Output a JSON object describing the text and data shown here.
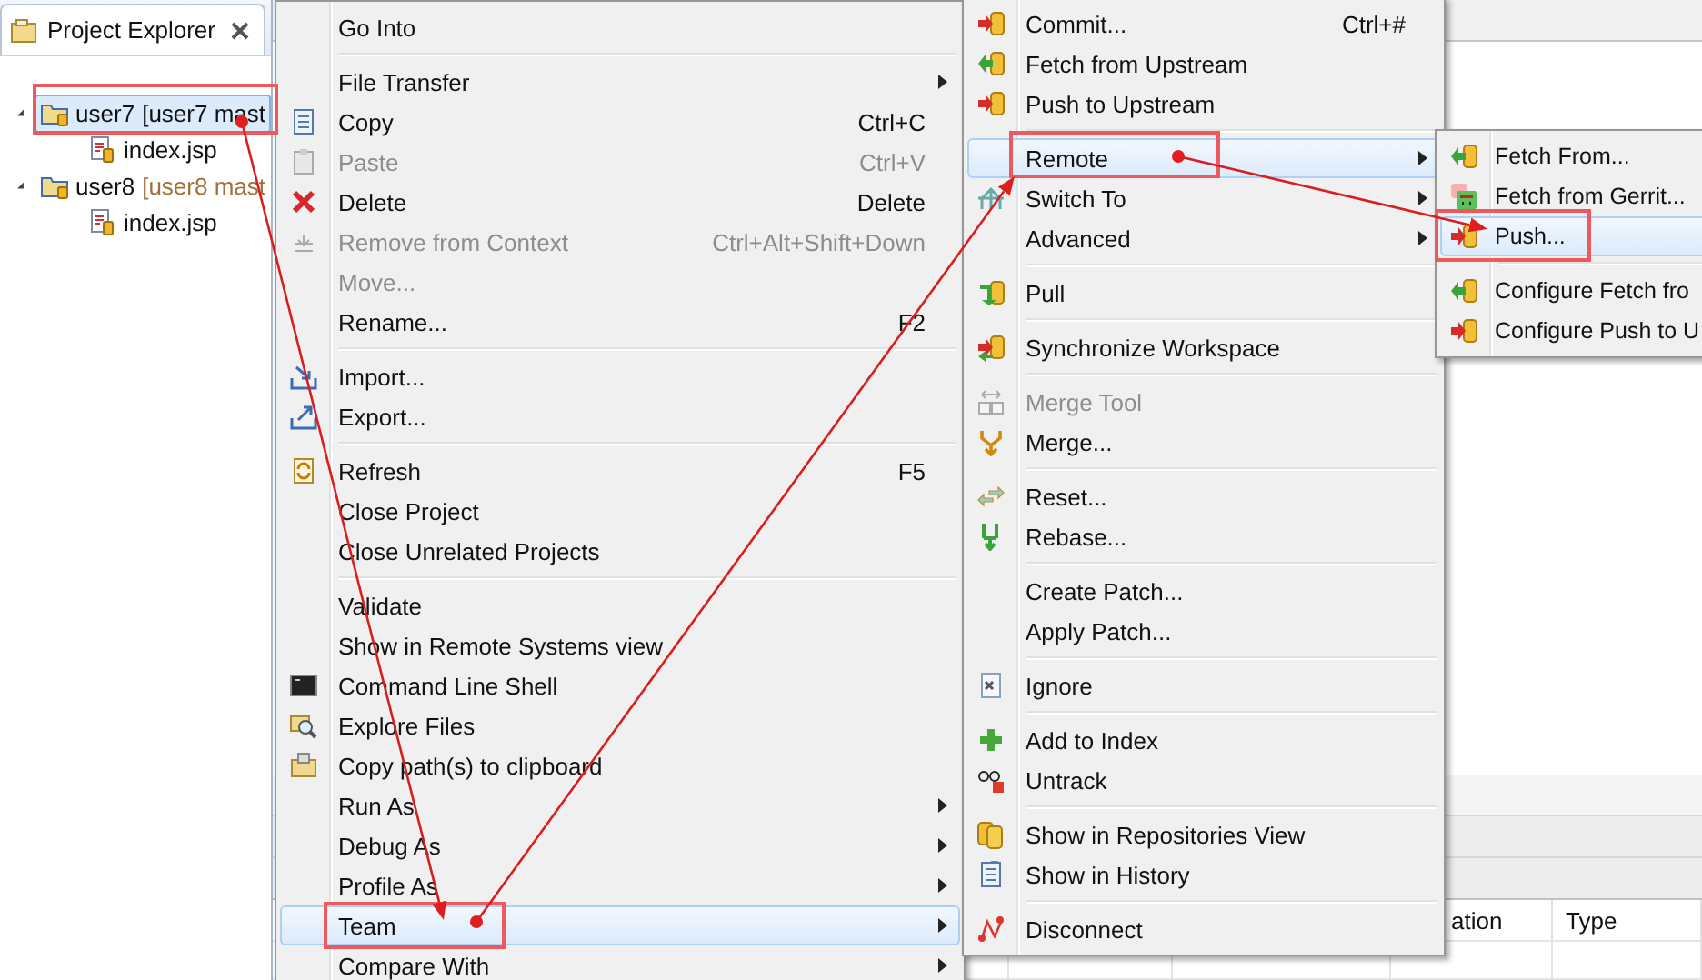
{
  "explorer": {
    "title": "Project Explorer",
    "tree": [
      {
        "name": "user7",
        "decoration": "[user7 mast",
        "selected": true,
        "expanded": true,
        "children": [
          {
            "name": "index.jsp",
            "selected": false
          }
        ]
      },
      {
        "name": "user8",
        "decoration": "[user8 mast",
        "selected": false,
        "expanded": true,
        "children": [
          {
            "name": "index.jsp",
            "selected": false
          }
        ]
      }
    ]
  },
  "context_menu": {
    "items": [
      {
        "kind": "item",
        "label": "Go Into",
        "submenu": false,
        "disabled": false,
        "selected": false
      },
      {
        "kind": "separator"
      },
      {
        "kind": "item",
        "label": "File Transfer",
        "submenu": true,
        "disabled": false,
        "selected": false
      },
      {
        "kind": "item",
        "label": "Copy",
        "shortcut": "Ctrl+C",
        "submenu": false,
        "disabled": false,
        "selected": false
      },
      {
        "kind": "item",
        "label": "Paste",
        "shortcut": "Ctrl+V",
        "submenu": false,
        "disabled": true,
        "selected": false
      },
      {
        "kind": "item",
        "label": "Delete",
        "shortcut": "Delete",
        "submenu": false,
        "disabled": false,
        "selected": false
      },
      {
        "kind": "item",
        "label": "Remove from Context",
        "shortcut": "Ctrl+Alt+Shift+Down",
        "submenu": false,
        "disabled": true,
        "selected": false
      },
      {
        "kind": "item",
        "label": "Move...",
        "submenu": false,
        "disabled": true,
        "selected": false
      },
      {
        "kind": "item",
        "label": "Rename...",
        "shortcut": "F2",
        "submenu": false,
        "disabled": false,
        "selected": false
      },
      {
        "kind": "separator"
      },
      {
        "kind": "item",
        "label": "Import...",
        "submenu": false,
        "disabled": false,
        "selected": false
      },
      {
        "kind": "item",
        "label": "Export...",
        "submenu": false,
        "disabled": false,
        "selected": false
      },
      {
        "kind": "separator"
      },
      {
        "kind": "item",
        "label": "Refresh",
        "shortcut": "F5",
        "submenu": false,
        "disabled": false,
        "selected": false
      },
      {
        "kind": "item",
        "label": "Close Project",
        "submenu": false,
        "disabled": false,
        "selected": false
      },
      {
        "kind": "item",
        "label": "Close Unrelated Projects",
        "submenu": false,
        "disabled": false,
        "selected": false
      },
      {
        "kind": "separator"
      },
      {
        "kind": "item",
        "label": "Validate",
        "submenu": false,
        "disabled": false,
        "selected": false
      },
      {
        "kind": "item",
        "label": "Show in Remote Systems view",
        "submenu": false,
        "disabled": false,
        "selected": false
      },
      {
        "kind": "item",
        "label": "Command Line Shell",
        "submenu": false,
        "disabled": false,
        "selected": false
      },
      {
        "kind": "item",
        "label": "Explore Files",
        "submenu": false,
        "disabled": false,
        "selected": false
      },
      {
        "kind": "item",
        "label": "Copy path(s) to clipboard",
        "submenu": false,
        "disabled": false,
        "selected": false
      },
      {
        "kind": "item",
        "label": "Run As",
        "submenu": true,
        "disabled": false,
        "selected": false
      },
      {
        "kind": "item",
        "label": "Debug As",
        "submenu": true,
        "disabled": false,
        "selected": false
      },
      {
        "kind": "item",
        "label": "Profile As",
        "submenu": true,
        "disabled": false,
        "selected": false
      },
      {
        "kind": "item",
        "label": "Team",
        "submenu": true,
        "disabled": false,
        "selected": true
      },
      {
        "kind": "item",
        "label": "Compare With",
        "submenu": true,
        "disabled": false,
        "selected": false
      }
    ]
  },
  "team_menu": {
    "items": [
      {
        "kind": "item",
        "label": "Commit...",
        "shortcut": "Ctrl+#",
        "submenu": false,
        "disabled": false,
        "selected": false
      },
      {
        "kind": "item",
        "label": "Fetch from Upstream",
        "submenu": false,
        "disabled": false,
        "selected": false
      },
      {
        "kind": "item",
        "label": "Push to Upstream",
        "submenu": false,
        "disabled": false,
        "selected": false
      },
      {
        "kind": "separator"
      },
      {
        "kind": "item",
        "label": "Remote",
        "submenu": true,
        "disabled": false,
        "selected": true
      },
      {
        "kind": "item",
        "label": "Switch To",
        "submenu": true,
        "disabled": false,
        "selected": false
      },
      {
        "kind": "item",
        "label": "Advanced",
        "submenu": true,
        "disabled": false,
        "selected": false
      },
      {
        "kind": "separator"
      },
      {
        "kind": "item",
        "label": "Pull",
        "submenu": false,
        "disabled": false,
        "selected": false
      },
      {
        "kind": "separator"
      },
      {
        "kind": "item",
        "label": "Synchronize Workspace",
        "submenu": false,
        "disabled": false,
        "selected": false
      },
      {
        "kind": "separator"
      },
      {
        "kind": "item",
        "label": "Merge Tool",
        "submenu": false,
        "disabled": true,
        "selected": false
      },
      {
        "kind": "item",
        "label": "Merge...",
        "submenu": false,
        "disabled": false,
        "selected": false
      },
      {
        "kind": "separator"
      },
      {
        "kind": "item",
        "label": "Reset...",
        "submenu": false,
        "disabled": false,
        "selected": false
      },
      {
        "kind": "item",
        "label": "Rebase...",
        "submenu": false,
        "disabled": false,
        "selected": false
      },
      {
        "kind": "separator"
      },
      {
        "kind": "item",
        "label": "Create Patch...",
        "submenu": false,
        "disabled": false,
        "selected": false
      },
      {
        "kind": "item",
        "label": "Apply Patch...",
        "submenu": false,
        "disabled": false,
        "selected": false
      },
      {
        "kind": "separator"
      },
      {
        "kind": "item",
        "label": "Ignore",
        "submenu": false,
        "disabled": false,
        "selected": false
      },
      {
        "kind": "separator"
      },
      {
        "kind": "item",
        "label": "Add to Index",
        "submenu": false,
        "disabled": false,
        "selected": false
      },
      {
        "kind": "item",
        "label": "Untrack",
        "submenu": false,
        "disabled": false,
        "selected": false
      },
      {
        "kind": "separator"
      },
      {
        "kind": "item",
        "label": "Show in Repositories View",
        "submenu": false,
        "disabled": false,
        "selected": false
      },
      {
        "kind": "item",
        "label": "Show in History",
        "submenu": false,
        "disabled": false,
        "selected": false
      },
      {
        "kind": "separator"
      },
      {
        "kind": "item",
        "label": "Disconnect",
        "submenu": false,
        "disabled": false,
        "selected": false
      }
    ]
  },
  "remote_menu": {
    "items": [
      {
        "kind": "item",
        "label": "Fetch From...",
        "submenu": false,
        "disabled": false,
        "selected": false
      },
      {
        "kind": "item",
        "label": "Fetch from Gerrit...",
        "submenu": false,
        "disabled": false,
        "selected": false
      },
      {
        "kind": "item",
        "label": "Push...",
        "submenu": false,
        "disabled": false,
        "selected": true
      },
      {
        "kind": "separator"
      },
      {
        "kind": "item",
        "label": "Configure Fetch fro",
        "submenu": false,
        "disabled": false,
        "selected": false
      },
      {
        "kind": "item",
        "label": "Configure Push to U",
        "submenu": false,
        "disabled": false,
        "selected": false
      }
    ]
  },
  "bottom_panel": {
    "columns": [
      "ation",
      "Type"
    ]
  }
}
